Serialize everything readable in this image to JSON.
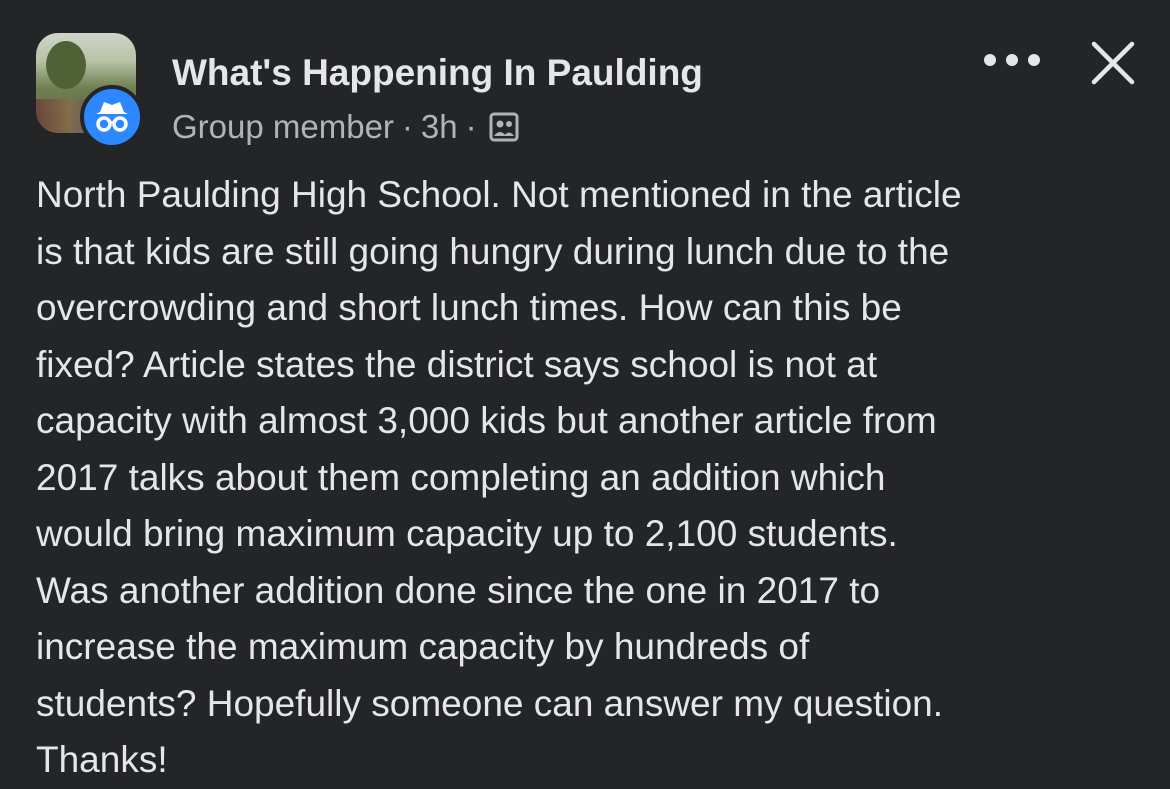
{
  "post": {
    "group_name": "What's Happening In Paulding",
    "author_role": "Group member",
    "separator": "·",
    "time_ago": "3h",
    "audience_icon": "group-audience-icon",
    "lines": [
      "North Paulding High School. Not mentioned in the article",
      "is that kids are still going hungry during lunch due to the",
      "overcrowding and short lunch times. How can this be",
      "fixed? Article states the district says school is not at",
      "capacity with almost 3,000 kids but another article from",
      "2017 talks about them completing an addition which",
      "would bring maximum capacity up to 2,100 students.",
      "Was another addition done since the one in 2017 to",
      "increase the maximum capacity by hundreds of",
      "students? Hopefully someone can answer my question.",
      "Thanks!"
    ]
  },
  "colors": {
    "background": "#242526",
    "text_primary": "#e4e6eb",
    "text_secondary": "#b0b3b8",
    "anon_badge": "#2d88ff"
  }
}
